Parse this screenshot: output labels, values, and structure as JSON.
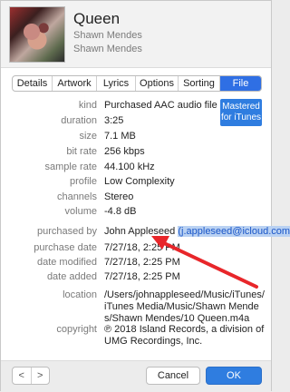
{
  "header": {
    "title": "Queen",
    "artist": "Shawn Mendes",
    "album": "Shawn Mendes"
  },
  "tabs": [
    {
      "label": "Details",
      "active": false
    },
    {
      "label": "Artwork",
      "active": false
    },
    {
      "label": "Lyrics",
      "active": false
    },
    {
      "label": "Options",
      "active": false
    },
    {
      "label": "Sorting",
      "active": false
    },
    {
      "label": "File",
      "active": true
    }
  ],
  "mastered_badge": "Mastered for iTunes",
  "info": {
    "kind": {
      "label": "kind",
      "value": "Purchased AAC audio file"
    },
    "duration": {
      "label": "duration",
      "value": "3:25"
    },
    "size": {
      "label": "size",
      "value": "7.1 MB"
    },
    "bit_rate": {
      "label": "bit rate",
      "value": "256 kbps"
    },
    "sample_rate": {
      "label": "sample rate",
      "value": "44.100 kHz"
    },
    "profile": {
      "label": "profile",
      "value": "Low Complexity"
    },
    "channels": {
      "label": "channels",
      "value": "Stereo"
    },
    "volume": {
      "label": "volume",
      "value": "-4.8 dB"
    },
    "purchased_by": {
      "label": "purchased by",
      "name": "John Appleseed",
      "email": "(j.appleseed@icloud.com)"
    },
    "purchase_date": {
      "label": "purchase date",
      "value": "7/27/18, 2:25 PM"
    },
    "date_modified": {
      "label": "date modified",
      "value": "7/27/18, 2:25 PM"
    },
    "date_added": {
      "label": "date added",
      "value": "7/27/18, 2:25 PM"
    },
    "location": {
      "label": "location",
      "value": "/Users/johnappleseed/Music/iTunes/iTunes Media/Music/Shawn Mendes/Shawn Mendes/10 Queen.m4a"
    },
    "copyright": {
      "label": "copyright",
      "value": "℗ 2018 Island Records, a division of UMG Recordings, Inc."
    }
  },
  "footer": {
    "prev": "<",
    "next": ">",
    "cancel": "Cancel",
    "ok": "OK"
  },
  "colors": {
    "accent": "#2f7de0",
    "annotation_arrow": "#e8262a",
    "highlight": "#b9d1f2"
  }
}
